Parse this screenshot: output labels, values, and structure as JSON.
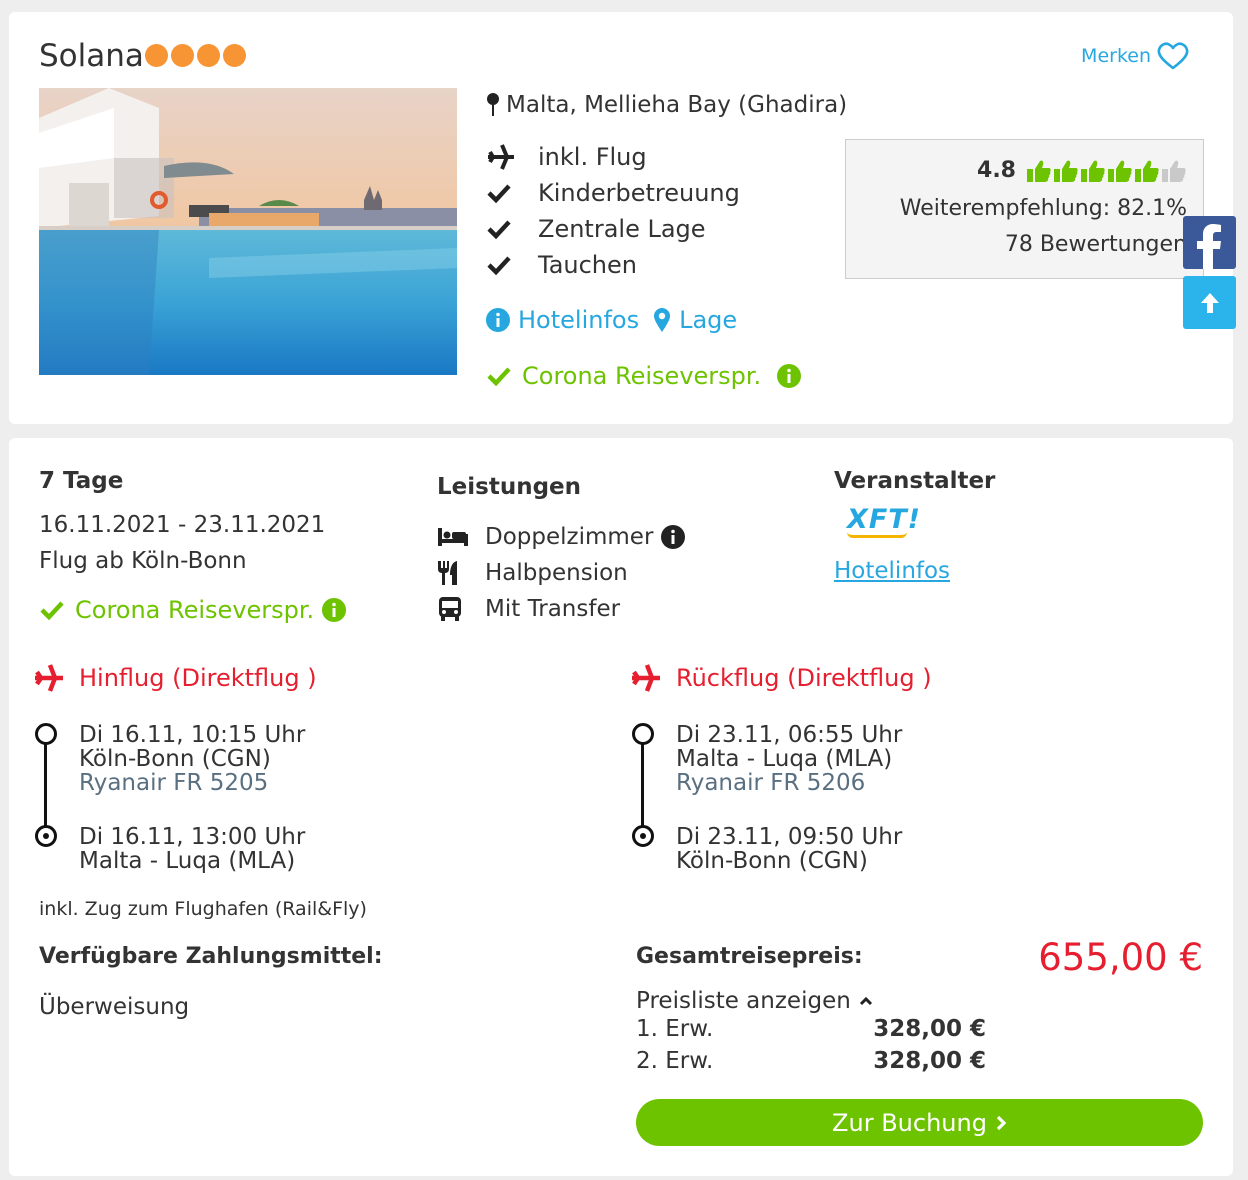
{
  "hotel": {
    "name": "Solana",
    "star_count": 4,
    "merken_label": "Merken",
    "location": "Malta, Mellieha Bay (Ghadira)",
    "features": [
      "inkl. Flug",
      "Kinderbetreuung",
      "Zentrale Lage",
      "Tauchen"
    ],
    "link_hotelinfos": "Hotelinfos",
    "link_lage": "Lage",
    "corona_label": "Corona Reiseverspr."
  },
  "rating": {
    "score": "4.8",
    "thumbs_total": 6,
    "thumbs_filled": 5,
    "recommendation": "Weiterempfehlung: 82.1%",
    "reviews": "78 Bewertungen"
  },
  "offer": {
    "duration": "7 Tage",
    "dates": "16.11.2021 - 23.11.2021",
    "departure": "Flug ab Köln-Bonn",
    "corona_label": "Corona Reiseverspr.",
    "leistungen_title": "Leistungen",
    "leistungen": [
      "Doppelzimmer",
      "Halbpension",
      "Mit Transfer"
    ],
    "veranstalter_title": "Veranstalter",
    "veranstalter_logo": "XFT!",
    "veranstalter_link": "Hotelinfos"
  },
  "flights": {
    "outbound": {
      "title": "Hinflug (Direktflug )",
      "dep_time": "Di 16.11, 10:15 Uhr",
      "dep_airport": "Köln-Bonn (CGN)",
      "airline": "Ryanair FR 5205",
      "arr_time": "Di 16.11, 13:00 Uhr",
      "arr_airport": "Malta - Luqa (MLA)"
    },
    "return": {
      "title": "Rückflug (Direktflug )",
      "dep_time": "Di 23.11, 06:55 Uhr",
      "dep_airport": "Malta - Luqa (MLA)",
      "airline": "Ryanair FR 5206",
      "arr_time": "Di 23.11, 09:50 Uhr",
      "arr_airport": "Köln-Bonn (CGN)"
    },
    "rail_note": "inkl. Zug zum Flughafen (Rail&Fly)"
  },
  "payment": {
    "title": "Verfügbare Zahlungsmittel:",
    "method": "Überweisung"
  },
  "price": {
    "total_label": "Gesamtreisepreis:",
    "total": "655,00 €",
    "pricelist_toggle": "Preisliste anzeigen",
    "rows": [
      {
        "label": "1. Erw.",
        "value": "328,00 €"
      },
      {
        "label": "2. Erw.",
        "value": "328,00 €"
      }
    ],
    "book_button": "Zur Buchung"
  },
  "colors": {
    "accent_blue": "#27a7e0",
    "green": "#6ec300",
    "red": "#e51f2f",
    "star_orange": "#f79433",
    "facebook": "#3b5998"
  },
  "icons": {
    "facebook": "facebook-icon",
    "scroll_up": "arrow-up-icon"
  }
}
